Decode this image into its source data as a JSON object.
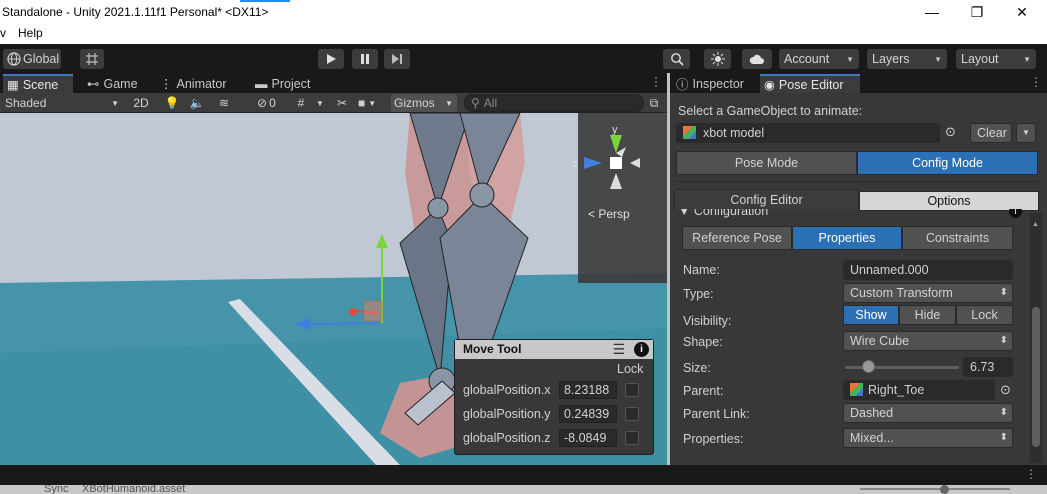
{
  "window": {
    "title": "Standalone - Unity 2021.1.11f1 Personal* <DX11>",
    "minimize_glyph": "—",
    "maximize_glyph": "❐",
    "close_glyph": "✕"
  },
  "menu": {
    "items": [
      "v",
      "Help"
    ]
  },
  "toolbar": {
    "global_label": "Global",
    "account_label": "Account",
    "layers_label": "Layers",
    "layout_label": "Layout"
  },
  "scene_tabs": [
    {
      "label": "Scene",
      "icon": "grid-icon"
    },
    {
      "label": "Game",
      "icon": "gamepad-icon"
    },
    {
      "label": "Animator",
      "icon": "animator-icon"
    },
    {
      "label": "Project",
      "icon": "folder-icon"
    }
  ],
  "scene_toolbar": {
    "shading_mode": "Shaded",
    "mode_2d": "2D",
    "hidden_count": "0",
    "gizmos_label": "Gizmos",
    "search_placeholder": "All"
  },
  "viewport": {
    "persp_label": "Persp",
    "axis_y": "y",
    "axis_z": "z"
  },
  "move_tool": {
    "title": "Move Tool",
    "lock_header": "Lock",
    "rows": [
      {
        "label": "globalPosition.x",
        "value": "8.23188"
      },
      {
        "label": "globalPosition.y",
        "value": "0.24839"
      },
      {
        "label": "globalPosition.z",
        "value": "-8.0849"
      }
    ]
  },
  "right_tabs": [
    {
      "label": "Inspector",
      "icon": "info-icon"
    },
    {
      "label": "Pose Editor",
      "icon": "eye-icon"
    }
  ],
  "pose_editor": {
    "select_prompt": "Select a GameObject to animate:",
    "target_object": "xbot model",
    "clear_label": "Clear",
    "mode_buttons": [
      "Pose Mode",
      "Config Mode"
    ],
    "active_mode": "Config Mode",
    "sub_tabs": [
      "Config Editor",
      "Options"
    ],
    "section_title": "Configuration",
    "config_tabs": [
      "Reference Pose",
      "Properties",
      "Constraints"
    ],
    "active_config_tab": "Properties",
    "fields": {
      "name_label": "Name:",
      "name_value": "Unnamed.000",
      "type_label": "Type:",
      "type_value": "Custom Transform",
      "visibility_label": "Visibility:",
      "visibility_options": [
        "Show",
        "Hide",
        "Lock"
      ],
      "visibility_selected": "Show",
      "shape_label": "Shape:",
      "shape_value": "Wire Cube",
      "size_label": "Size:",
      "size_value": "6.73",
      "size_fraction": 0.2,
      "parent_label": "Parent:",
      "parent_value": "Right_Toe",
      "parent_link_label": "Parent Link:",
      "parent_link_value": "Dashed",
      "properties_label": "Properties:",
      "properties_value": "Mixed..."
    }
  },
  "status": {
    "sync_text": "Sync",
    "asset_text": "XBotHumanoid.asset"
  },
  "colors": {
    "accent_blue": "#2b6fb5",
    "sky": "#c0c8d4",
    "sea": "#3f8fa5",
    "panel_bg": "#383838"
  }
}
